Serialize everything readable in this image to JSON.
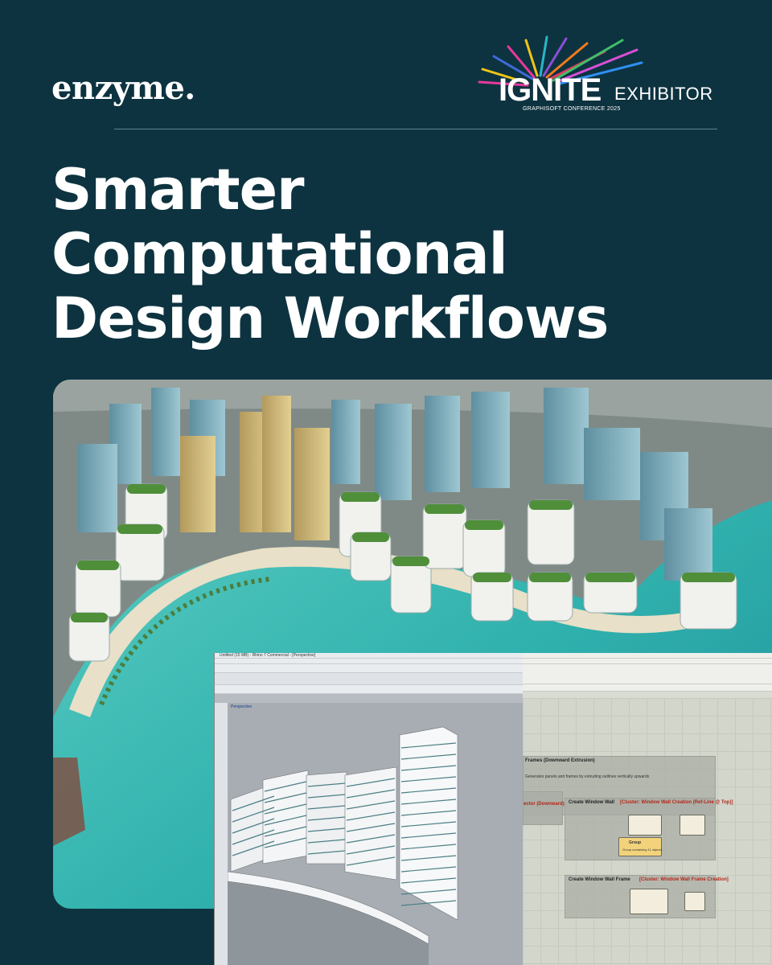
{
  "brand": {
    "name": "enzyme."
  },
  "badge": {
    "event": "IGNITE",
    "event_sub": "GRAPHISOFT CONFERENCE 2025",
    "role": "EXHIBITOR"
  },
  "headline": {
    "lines": [
      "Smarter",
      "Computational",
      "Design Workflows"
    ]
  },
  "screens": {
    "rhino": {
      "title": "Untitled (15 MB) - Rhino 7 Commercial - [Perspective]",
      "viewport_label": "Perspective"
    },
    "grasshopper": {
      "group1_title": "Frames (Downward Extrusion)",
      "group1_note": "Generates panels and frames by extruding outlines vertically upwards",
      "cluster_a_label": "Create Window Wall",
      "cluster_a_title": "[Cluster: Window Wall Creation (Ref-Line @ Top)]",
      "cluster_b_label": "Create Window Wall Frame",
      "cluster_b_title": "[Cluster: Window Wall Frame Creation]",
      "left_node": "ector (Downward)",
      "group_node": "Group",
      "group_node_sub": "Group containing 11 objects"
    }
  },
  "colors": {
    "background": "#0d3340",
    "text": "#ffffff",
    "divider": "#5c8591",
    "sea": "#3fb8b0"
  }
}
